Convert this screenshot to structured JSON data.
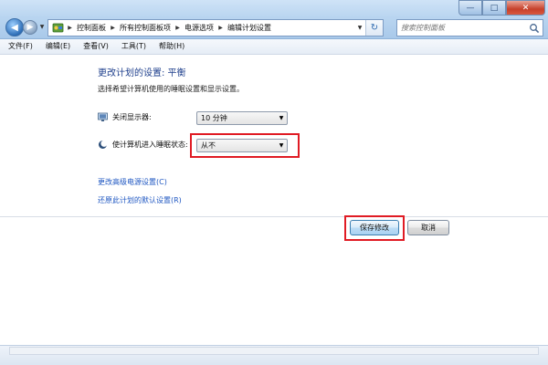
{
  "window": {
    "controls": {
      "minimize": "—",
      "maximize": "□",
      "close": "✕"
    }
  },
  "address": {
    "crumbs": [
      "控制面板",
      "所有控制面板项",
      "电源选项",
      "编辑计划设置"
    ]
  },
  "search": {
    "placeholder": "搜索控制面板"
  },
  "menu": [
    "文件(F)",
    "编辑(E)",
    "查看(V)",
    "工具(T)",
    "帮助(H)"
  ],
  "main": {
    "title": "更改计划的设置: 平衡",
    "subtitle": "选择希望计算机使用的睡眠设置和显示设置。",
    "display_off": {
      "label": "关闭显示器:",
      "value": "10 分钟"
    },
    "sleep": {
      "label": "使计算机进入睡眠状态:",
      "value": "从不"
    },
    "links": {
      "advanced": "更改高级电源设置(C)",
      "restore": "还原此计划的默认设置(R)"
    },
    "buttons": {
      "save": "保存修改",
      "cancel": "取消"
    }
  },
  "colors": {
    "highlight": "#e01b24",
    "link": "#1f57c2",
    "title": "#1e3f8c"
  }
}
